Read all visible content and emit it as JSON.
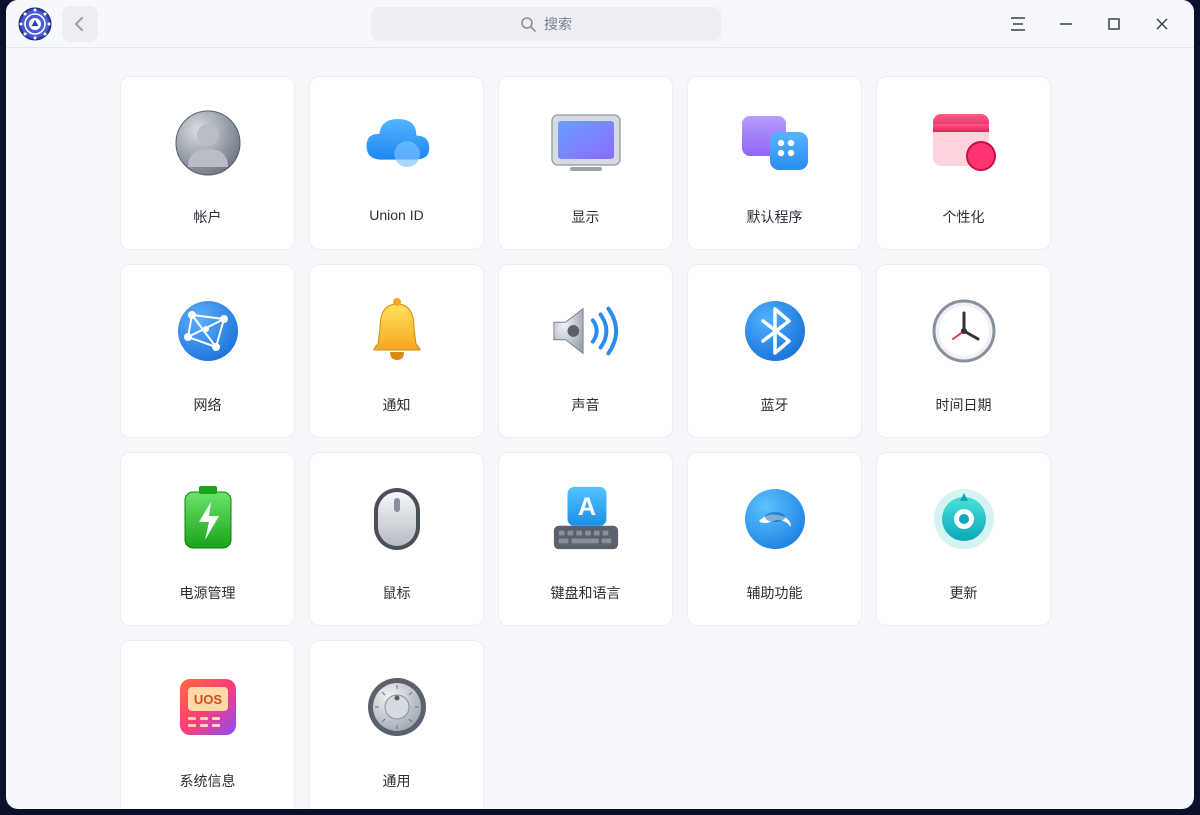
{
  "search": {
    "placeholder": "搜索"
  },
  "items": [
    {
      "id": "accounts",
      "label": "帐户"
    },
    {
      "id": "union-id",
      "label": "Union ID"
    },
    {
      "id": "display",
      "label": "显示"
    },
    {
      "id": "default-apps",
      "label": "默认程序"
    },
    {
      "id": "personalization",
      "label": "个性化"
    },
    {
      "id": "network",
      "label": "网络"
    },
    {
      "id": "notification",
      "label": "通知"
    },
    {
      "id": "sound",
      "label": "声音"
    },
    {
      "id": "bluetooth",
      "label": "蓝牙"
    },
    {
      "id": "datetime",
      "label": "时间日期"
    },
    {
      "id": "power",
      "label": "电源管理"
    },
    {
      "id": "mouse",
      "label": "鼠标"
    },
    {
      "id": "keyboard-lang",
      "label": "键盘和语言"
    },
    {
      "id": "accessibility",
      "label": "辅助功能"
    },
    {
      "id": "update",
      "label": "更新"
    },
    {
      "id": "systeminfo",
      "label": "系统信息"
    },
    {
      "id": "general",
      "label": "通用"
    }
  ]
}
